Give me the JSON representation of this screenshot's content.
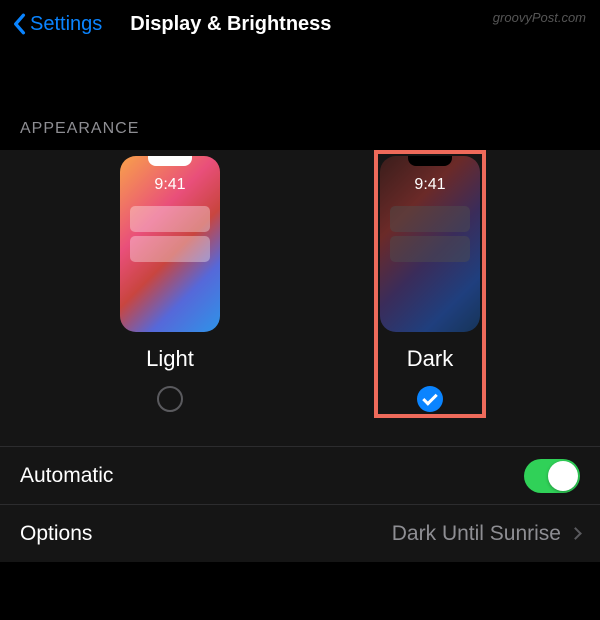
{
  "watermark": "groovyPost.com",
  "header": {
    "back_label": "Settings",
    "title": "Display & Brightness"
  },
  "section": {
    "appearance_header": "APPEARANCE"
  },
  "appearance": {
    "preview_time": "9:41",
    "options": {
      "light": {
        "label": "Light",
        "selected": false
      },
      "dark": {
        "label": "Dark",
        "selected": true
      }
    }
  },
  "rows": {
    "automatic": {
      "label": "Automatic",
      "enabled": true
    },
    "options": {
      "label": "Options",
      "value": "Dark Until Sunrise"
    }
  }
}
